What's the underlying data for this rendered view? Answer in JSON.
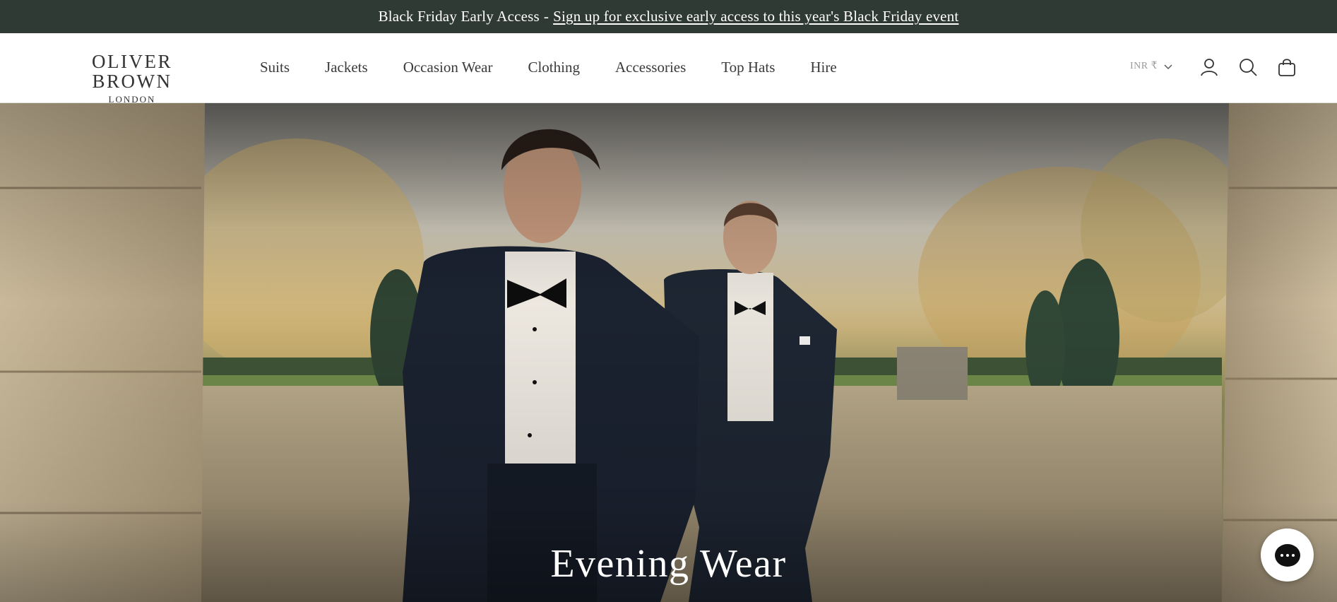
{
  "announcement": {
    "lead_text": "Black Friday Early Access",
    "separator": "-",
    "link_text": "Sign up for exclusive early access to this year's Black Friday event"
  },
  "header": {
    "brand_name": "OLIVER BROWN",
    "brand_city": "LONDON",
    "nav_items": [
      {
        "label": "Suits"
      },
      {
        "label": "Jackets"
      },
      {
        "label": "Occasion Wear"
      },
      {
        "label": "Clothing"
      },
      {
        "label": "Accessories"
      },
      {
        "label": "Top Hats"
      },
      {
        "label": "Hire"
      }
    ],
    "currency_label": "INR ₹",
    "icons": {
      "currency_dropdown": "chevron-down-icon",
      "account": "user-icon",
      "search": "search-icon",
      "cart": "shopping-bag-icon"
    }
  },
  "hero": {
    "title": "Evening Wear"
  },
  "chat": {
    "icon": "chat-bubble-icon"
  },
  "colors": {
    "announcement_bg": "#2f3a34",
    "header_bg": "#ffffff",
    "text_dark": "#3a3a3a",
    "hero_title": "#ffffff"
  }
}
